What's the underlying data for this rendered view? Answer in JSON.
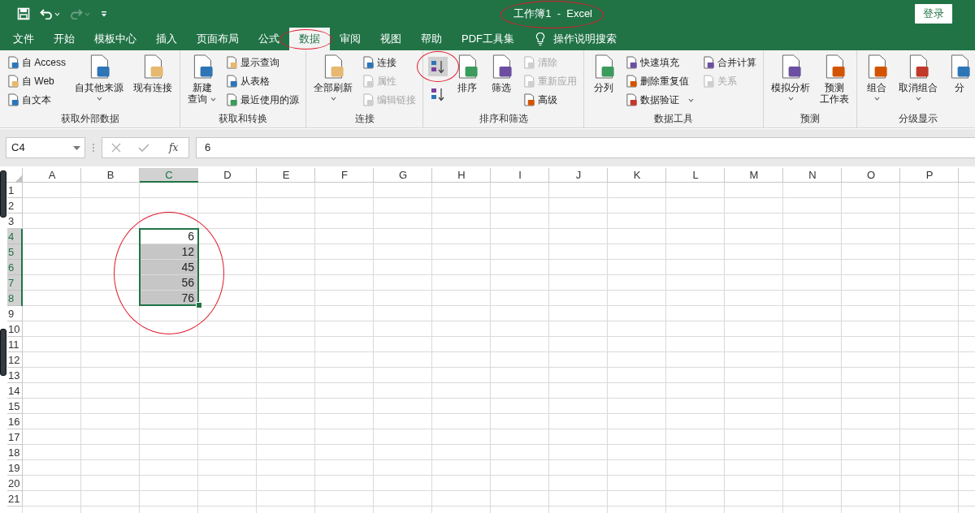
{
  "quick_access": [
    {
      "kind": "save",
      "disabled": false,
      "dropdown": false
    },
    {
      "kind": "undo",
      "disabled": false,
      "dropdown": true
    },
    {
      "kind": "redo",
      "disabled": true,
      "dropdown": true
    },
    {
      "kind": "customize",
      "disabled": false,
      "dropdown": false
    }
  ],
  "title": {
    "text": "工作簿1  -  Excel",
    "circled": true
  },
  "account": {
    "label": "登录"
  },
  "tabs": [
    {
      "label": "文件",
      "selected": false,
      "circled": false
    },
    {
      "label": "开始",
      "selected": false,
      "circled": false
    },
    {
      "label": "模板中心",
      "selected": false,
      "circled": false
    },
    {
      "label": "插入",
      "selected": false,
      "circled": false
    },
    {
      "label": "页面布局",
      "selected": false,
      "circled": false
    },
    {
      "label": "公式",
      "selected": false,
      "circled": false
    },
    {
      "label": "数据",
      "selected": true,
      "circled": true
    },
    {
      "label": "审阅",
      "selected": false,
      "circled": false
    },
    {
      "label": "视图",
      "selected": false,
      "circled": false
    },
    {
      "label": "帮助",
      "selected": false,
      "circled": false
    },
    {
      "label": "PDF工具集",
      "selected": false,
      "circled": false
    }
  ],
  "tell_me": {
    "label": "操作说明搜索"
  },
  "ribbon": [
    {
      "label": "获取外部数据",
      "columns": [
        {
          "kind": "stack",
          "items": [
            {
              "label": "自 Access",
              "disabled": false,
              "dropdown": false
            },
            {
              "label": "自 Web",
              "disabled": false,
              "dropdown": false
            },
            {
              "label": "自文本",
              "disabled": false,
              "dropdown": false
            }
          ]
        },
        {
          "kind": "large",
          "lines": [
            "自其他来源"
          ],
          "dropdown": true,
          "disabled": false
        },
        {
          "kind": "large",
          "lines": [
            "现有连接"
          ],
          "dropdown": false,
          "disabled": false
        }
      ]
    },
    {
      "label": "获取和转换",
      "columns": [
        {
          "kind": "large",
          "lines": [
            "新建",
            "查询"
          ],
          "dropdown": true,
          "disabled": false
        },
        {
          "kind": "stack",
          "items": [
            {
              "label": "显示查询",
              "disabled": false,
              "dropdown": false
            },
            {
              "label": "从表格",
              "disabled": false,
              "dropdown": false
            },
            {
              "label": "最近使用的源",
              "disabled": false,
              "dropdown": false
            }
          ]
        }
      ]
    },
    {
      "label": "连接",
      "columns": [
        {
          "kind": "large",
          "lines": [
            "全部刷新"
          ],
          "dropdown": true,
          "disabled": false
        },
        {
          "kind": "stack",
          "items": [
            {
              "label": "连接",
              "disabled": false,
              "dropdown": false
            },
            {
              "label": "属性",
              "disabled": true,
              "dropdown": false
            },
            {
              "label": "编辑链接",
              "disabled": true,
              "dropdown": false
            }
          ]
        }
      ]
    },
    {
      "label": "排序和筛选",
      "columns": [
        {
          "kind": "sort",
          "items": [
            {
              "circled": true
            },
            {
              "circled": false
            }
          ]
        },
        {
          "kind": "large",
          "lines": [
            "排序"
          ],
          "dropdown": false,
          "disabled": false
        },
        {
          "kind": "large",
          "lines": [
            "筛选"
          ],
          "dropdown": false,
          "disabled": false
        },
        {
          "kind": "stack",
          "items": [
            {
              "label": "清除",
              "disabled": true,
              "dropdown": false
            },
            {
              "label": "重新应用",
              "disabled": true,
              "dropdown": false
            },
            {
              "label": "高级",
              "disabled": false,
              "dropdown": false
            }
          ]
        }
      ]
    },
    {
      "label": "数据工具",
      "columns": [
        {
          "kind": "large",
          "lines": [
            "分列"
          ],
          "dropdown": false,
          "disabled": false
        },
        {
          "kind": "stack",
          "items": [
            {
              "label": "快速填充",
              "disabled": false,
              "dropdown": false
            },
            {
              "label": "删除重复值",
              "disabled": false,
              "dropdown": false
            },
            {
              "label": "数据验证",
              "disabled": false,
              "dropdown": true
            }
          ]
        },
        {
          "kind": "stack",
          "items": [
            {
              "label": "合并计算",
              "disabled": false,
              "dropdown": false
            },
            {
              "label": "关系",
              "disabled": true,
              "dropdown": false
            }
          ]
        }
      ]
    },
    {
      "label": "预测",
      "columns": [
        {
          "kind": "large",
          "lines": [
            "模拟分析"
          ],
          "dropdown": true,
          "disabled": false
        },
        {
          "kind": "large",
          "lines": [
            "预测",
            "工作表"
          ],
          "dropdown": false,
          "disabled": false
        }
      ]
    },
    {
      "label": "分级显示",
      "columns": [
        {
          "kind": "large",
          "lines": [
            "组合"
          ],
          "dropdown": true,
          "disabled": false
        },
        {
          "kind": "large",
          "lines": [
            "取消组合"
          ],
          "dropdown": true,
          "disabled": false
        },
        {
          "kind": "large",
          "lines": [
            "分"
          ],
          "dropdown": false,
          "disabled": false
        }
      ]
    }
  ],
  "formula_bar": {
    "name_box": "C4",
    "fx": "fx",
    "value": "6"
  },
  "sheet": {
    "selection_circled": true,
    "columns": [
      {
        "label": "A",
        "selected": false
      },
      {
        "label": "B",
        "selected": false
      },
      {
        "label": "C",
        "selected": true
      },
      {
        "label": "D",
        "selected": false
      },
      {
        "label": "E",
        "selected": false
      },
      {
        "label": "F",
        "selected": false
      },
      {
        "label": "G",
        "selected": false
      },
      {
        "label": "H",
        "selected": false
      },
      {
        "label": "I",
        "selected": false
      },
      {
        "label": "J",
        "selected": false
      },
      {
        "label": "K",
        "selected": false
      },
      {
        "label": "L",
        "selected": false
      },
      {
        "label": "M",
        "selected": false
      },
      {
        "label": "N",
        "selected": false
      },
      {
        "label": "O",
        "selected": false
      },
      {
        "label": "P",
        "selected": false
      }
    ],
    "rows": [
      {
        "label": "1",
        "selected": false
      },
      {
        "label": "2",
        "selected": false
      },
      {
        "label": "3",
        "selected": false
      },
      {
        "label": "4",
        "selected": true,
        "cells": [
          null,
          null,
          {
            "value": "6",
            "shaded": false
          }
        ]
      },
      {
        "label": "5",
        "selected": true,
        "cells": [
          null,
          null,
          {
            "value": "12",
            "shaded": true
          }
        ]
      },
      {
        "label": "6",
        "selected": true,
        "cells": [
          null,
          null,
          {
            "value": "45",
            "shaded": true
          }
        ]
      },
      {
        "label": "7",
        "selected": true,
        "cells": [
          null,
          null,
          {
            "value": "56",
            "shaded": true
          }
        ]
      },
      {
        "label": "8",
        "selected": true,
        "cells": [
          null,
          null,
          {
            "value": "76",
            "shaded": true
          }
        ]
      },
      {
        "label": "9",
        "selected": false
      },
      {
        "label": "10",
        "selected": false
      },
      {
        "label": "11",
        "selected": false
      },
      {
        "label": "12",
        "selected": false
      },
      {
        "label": "13",
        "selected": false
      },
      {
        "label": "14",
        "selected": false
      },
      {
        "label": "15",
        "selected": false
      },
      {
        "label": "16",
        "selected": false
      },
      {
        "label": "17",
        "selected": false
      },
      {
        "label": "18",
        "selected": false
      },
      {
        "label": "19",
        "selected": false
      },
      {
        "label": "20",
        "selected": false
      },
      {
        "label": "21",
        "selected": false
      }
    ]
  }
}
